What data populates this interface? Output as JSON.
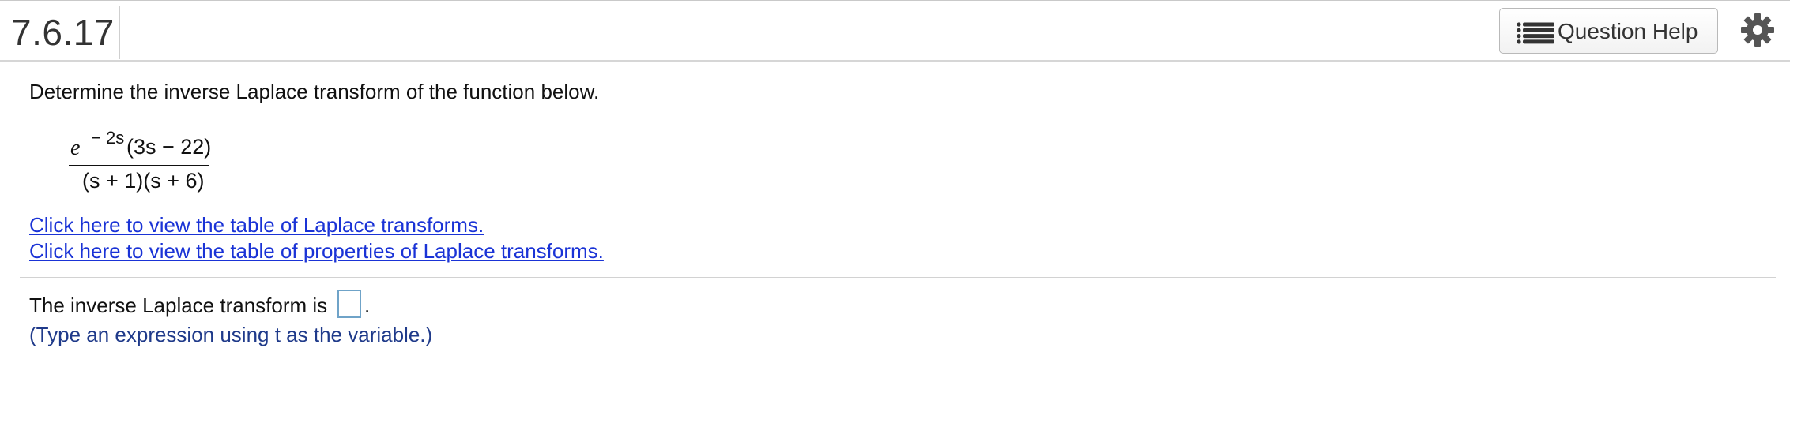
{
  "header": {
    "question_number": "7.6.17",
    "help_button_label": "Question Help",
    "help_icon": "list-icon",
    "settings_icon": "gear-icon"
  },
  "question": {
    "prompt": "Determine the inverse Laplace transform of the function below.",
    "expression": {
      "numerator_base": "e",
      "numerator_exponent": "− 2s",
      "numerator_rest": "(3s − 22)",
      "denominator": "(s + 1)(s + 6)"
    }
  },
  "links": {
    "laplace_table": "Click here to view the table of Laplace transforms.",
    "properties_table": "Click here to view the table of properties of Laplace transforms."
  },
  "answer": {
    "label": "The inverse Laplace transform is",
    "value": "",
    "trailing": ".",
    "hint": "(Type an expression using t as the variable.)"
  },
  "colors": {
    "link": "#1a33d6",
    "hint": "#1f3a8a",
    "input_border": "#6fa3c8"
  }
}
